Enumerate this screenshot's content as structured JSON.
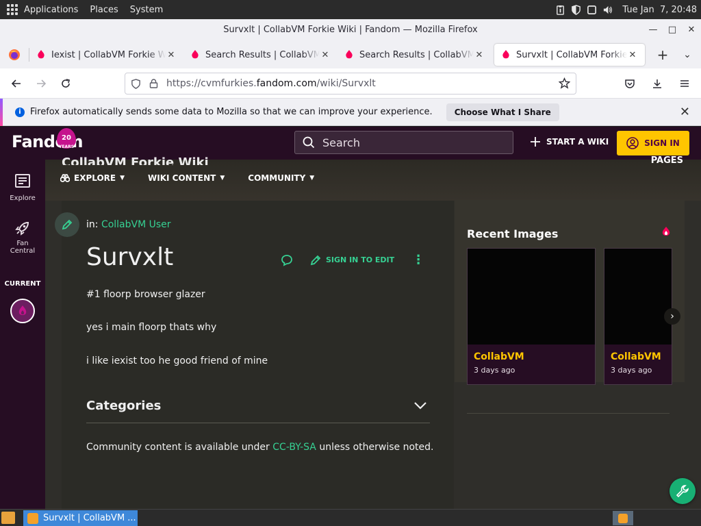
{
  "gnome": {
    "menus": [
      "Applications",
      "Places",
      "System"
    ],
    "datetime": "Tue Jan  7, 20:48"
  },
  "window": {
    "title": "Survxlt | CollabVM Forkie Wiki | Fandom — Mozilla Firefox"
  },
  "tabs": [
    {
      "label": "Iexist | CollabVM Forkie Wiki | Fandom"
    },
    {
      "label": "Search Results | CollabVM Forkie Wiki"
    },
    {
      "label": "Search Results | CollabVM Forkie Wiki"
    },
    {
      "label": "Survxlt | CollabVM Forkie Wiki | Fandom",
      "active": true
    }
  ],
  "url": {
    "prefix": "https://cvmfurkies.",
    "host": "fandom.com",
    "path": "/wiki/Survxlt"
  },
  "notification": {
    "text": "Firefox automatically sends some data to Mozilla so that we can improve your experience.",
    "button": "Choose What I Share"
  },
  "fandom": {
    "logo": "Fandom",
    "badge_number": "20",
    "badge_sub": "YEARS",
    "search_placeholder": "Search",
    "start_wiki": "START A WIKI",
    "sign_in": "SIGN IN",
    "sidebar": {
      "explore": "Explore",
      "fan_central_1": "Fan",
      "fan_central_2": "Central",
      "current": "CURRENT"
    },
    "wiki_name": "CollabVM Forkie Wiki",
    "pages_label": "PAGES",
    "nav": [
      "EXPLORE",
      "WIKI CONTENT",
      "COMMUNITY"
    ]
  },
  "article": {
    "in_label": "in:",
    "category_link": "CollabVM User",
    "title": "Survxlt",
    "sign_in_to_edit": "SIGN IN TO EDIT",
    "paragraphs": [
      "#1 floorp browser glazer",
      "yes i main floorp thats why",
      "i like iexist too he good friend of mine"
    ],
    "categories_label": "Categories",
    "license_pre": "Community content is available under ",
    "license_link": "CC-BY-SA",
    "license_post": " unless otherwise noted."
  },
  "rail": {
    "title": "Recent Images",
    "cards": [
      {
        "name": "CollabVM",
        "time": "3 days ago"
      },
      {
        "name": "CollabVM",
        "time": "3 days ago"
      }
    ]
  },
  "taskbar": {
    "task_label": "Survxlt | CollabVM ..."
  },
  "colors": {
    "fandom_purple": "#260d23",
    "fandom_yellow": "#ffc500",
    "fandom_green": "#36d193",
    "page_bg": "#2b2b26"
  }
}
